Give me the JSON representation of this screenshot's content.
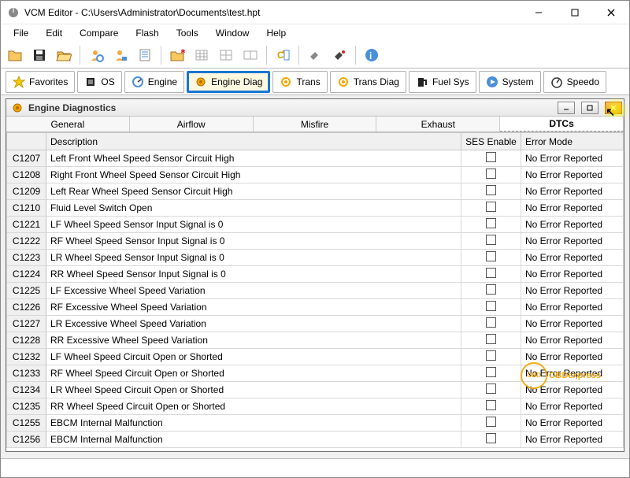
{
  "window": {
    "title": "VCM Editor - C:\\Users\\Administrator\\Documents\\test.hpt"
  },
  "menus": [
    "File",
    "Edit",
    "Compare",
    "Flash",
    "Tools",
    "Window",
    "Help"
  ],
  "categories": [
    {
      "label": "Favorites",
      "icon": "star"
    },
    {
      "label": "OS",
      "icon": "chip"
    },
    {
      "label": "Engine",
      "icon": "gauge"
    },
    {
      "label": "Engine Diag",
      "icon": "gear-warn",
      "active": true
    },
    {
      "label": "Trans",
      "icon": "gear"
    },
    {
      "label": "Trans Diag",
      "icon": "gear-warn2"
    },
    {
      "label": "Fuel Sys",
      "icon": "pump"
    },
    {
      "label": "System",
      "icon": "play"
    },
    {
      "label": "Speedo",
      "icon": "speedo"
    }
  ],
  "child_window": {
    "title": "Engine Diagnostics",
    "tabs": [
      "General",
      "Airflow",
      "Misfire",
      "Exhaust",
      "DTCs"
    ],
    "active_tab": "DTCs",
    "grid_headers": {
      "code": "",
      "desc": "Description",
      "ses": "SES Enable",
      "err": "Error Mode"
    },
    "rows": [
      {
        "code": "C1207",
        "desc": "Left Front Wheel Speed Sensor Circuit High",
        "ses": false,
        "err": "No Error Reported"
      },
      {
        "code": "C1208",
        "desc": "Right Front Wheel Speed Sensor Circuit High",
        "ses": false,
        "err": "No Error Reported"
      },
      {
        "code": "C1209",
        "desc": "Left Rear Wheel Speed Sensor Circuit High",
        "ses": false,
        "err": "No Error Reported"
      },
      {
        "code": "C1210",
        "desc": " Fluid Level Switch Open",
        "ses": false,
        "err": "No Error Reported"
      },
      {
        "code": "C1221",
        "desc": "LF Wheel Speed Sensor Input Signal is 0",
        "ses": false,
        "err": "No Error Reported"
      },
      {
        "code": "C1222",
        "desc": "RF Wheel Speed Sensor Input Signal is 0",
        "ses": false,
        "err": "No Error Reported"
      },
      {
        "code": "C1223",
        "desc": "LR Wheel Speed Sensor Input Signal is 0",
        "ses": false,
        "err": "No Error Reported"
      },
      {
        "code": "C1224",
        "desc": "RR Wheel Speed Sensor Input Signal is 0",
        "ses": false,
        "err": "No Error Reported"
      },
      {
        "code": "C1225",
        "desc": "LF Excessive Wheel Speed Variation",
        "ses": false,
        "err": "No Error Reported"
      },
      {
        "code": "C1226",
        "desc": "RF Excessive Wheel Speed Variation",
        "ses": false,
        "err": "No Error Reported"
      },
      {
        "code": "C1227",
        "desc": "LR Excessive Wheel Speed Variation",
        "ses": false,
        "err": "No Error Reported"
      },
      {
        "code": "C1228",
        "desc": "RR Excessive Wheel Speed Variation",
        "ses": false,
        "err": "No Error Reported"
      },
      {
        "code": "C1232",
        "desc": "LF Wheel Speed Circuit Open or Shorted",
        "ses": false,
        "err": "No Error Reported"
      },
      {
        "code": "C1233",
        "desc": "RF Wheel Speed Circuit Open or Shorted",
        "ses": false,
        "err": "No Error Reported"
      },
      {
        "code": "C1234",
        "desc": "LR Wheel Speed Circuit Open or Shorted",
        "ses": false,
        "err": "No Error Reported"
      },
      {
        "code": "C1235",
        "desc": "RR Wheel Speed Circuit Open or Shorted",
        "ses": false,
        "err": "No Error Reported"
      },
      {
        "code": "C1255",
        "desc": "EBCM Internal Malfunction",
        "ses": false,
        "err": "No Error Reported"
      },
      {
        "code": "C1256",
        "desc": "EBCM Internal Malfunction",
        "ses": false,
        "err": "No Error Reported"
      }
    ]
  },
  "watermark": {
    "text1": "OBDexpress",
    ".ext": ".co.uk"
  }
}
